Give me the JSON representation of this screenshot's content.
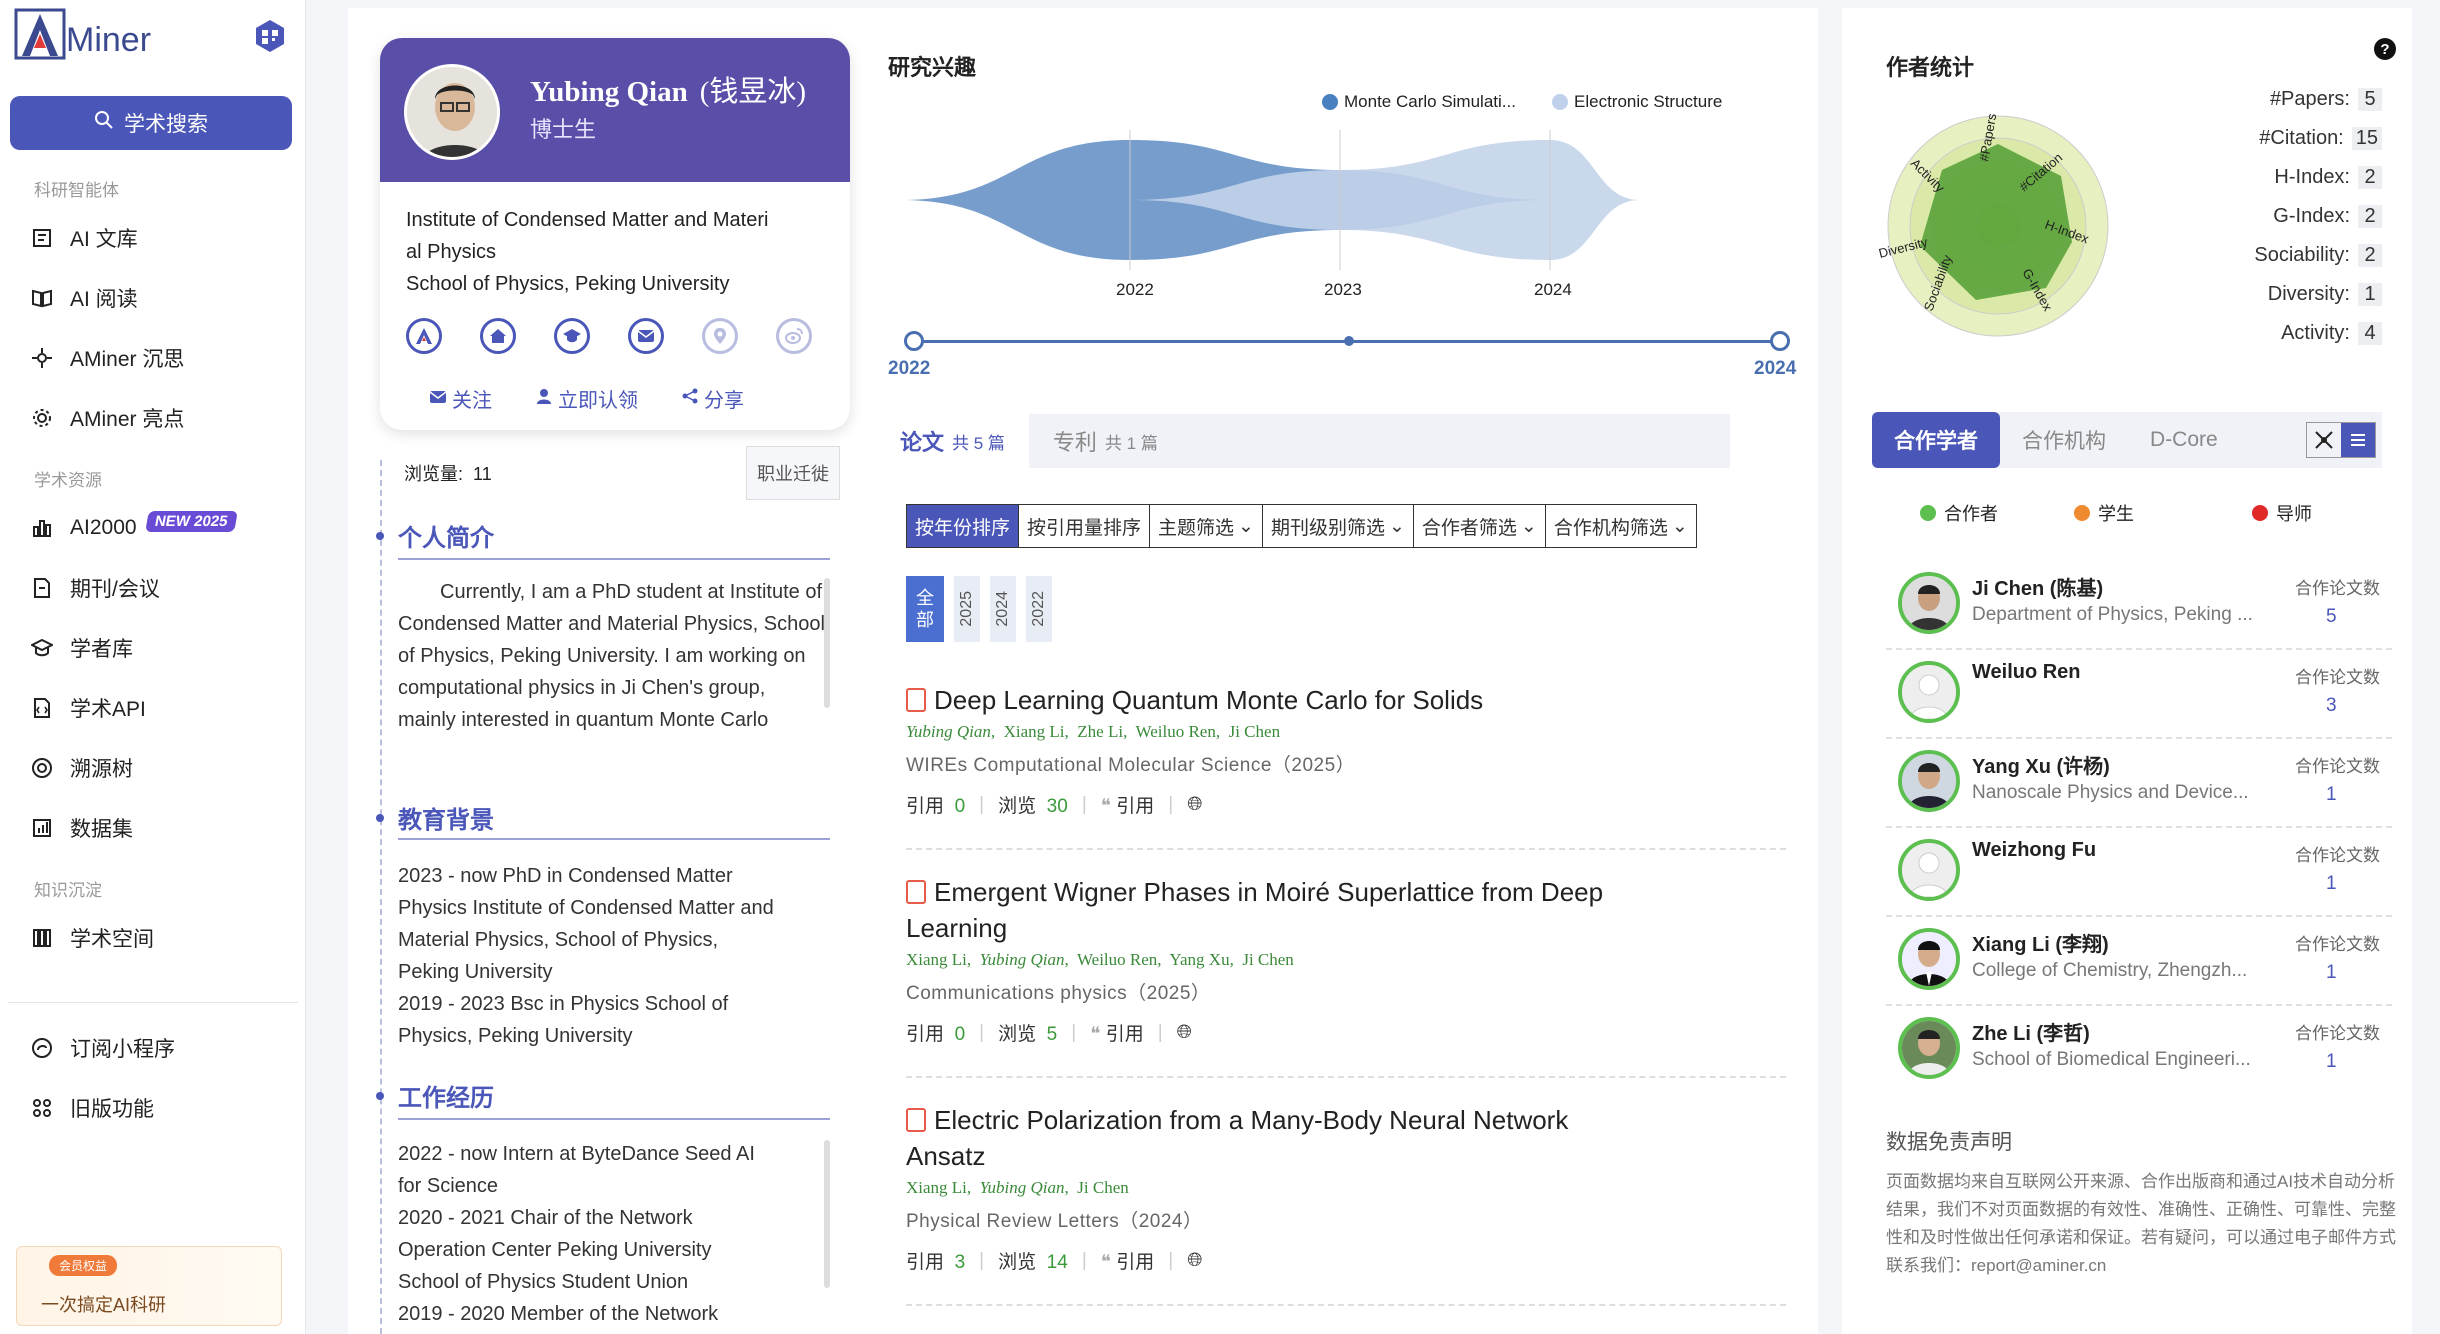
{
  "sidebar": {
    "logo_text": "Miner",
    "search_label": "学术搜索",
    "section1": "科研智能体",
    "section2": "学术资源",
    "section3": "知识沉淀",
    "items1": [
      "AI 文库",
      "AI 阅读",
      "AMiner 沉思",
      "AMiner 亮点"
    ],
    "items2": [
      "AI2000",
      "期刊/会议",
      "学者库",
      "学术API",
      "溯源树",
      "数据集"
    ],
    "items3": [
      "学术空间"
    ],
    "items4": [
      "订阅小程序",
      "旧版功能"
    ],
    "new_badge": "NEW 2025",
    "promo_tag": "会员权益",
    "promo_text": "一次搞定AI科研"
  },
  "profile": {
    "name": "Yubing Qian",
    "name_cn": "(钱昱冰)",
    "title": "博士生",
    "affiliation": "Institute of Condensed Matter and Materi al Physics School of Physics, Peking University",
    "aff_line1": "Institute of Condensed Matter and Materi",
    "aff_line2": "al Physics",
    "aff_line3": "School of Physics, Peking University",
    "action_follow": "关注",
    "action_claim": "立即认领",
    "action_share": "分享",
    "views_label": "浏览量:",
    "views_value": "11",
    "career_btn": "职业迁徙"
  },
  "bio": {
    "title": "个人简介",
    "text": "Currently, I am a PhD student at Institute of Condensed Matter and Material Physics, School of Physics, Peking University. I am working on computational physics in Ji Chen's group, mainly interested in quantum Monte Carlo"
  },
  "education": {
    "title": "教育背景",
    "lines": [
      "2023 - now PhD in Condensed Matter",
      "Physics Institute of Condensed Matter and",
      "Material Physics, School of Physics,",
      "Peking University",
      "2019 - 2023 Bsc in Physics School of",
      "Physics, Peking University"
    ]
  },
  "work": {
    "title": "工作经历",
    "lines": [
      "2022 - now Intern at ByteDance Seed AI",
      "for Science",
      "2020 - 2021 Chair of the Network",
      "Operation Center Peking University",
      "School of Physics Student Union",
      "2019 - 2020 Member of the Network"
    ]
  },
  "research": {
    "title": "研究兴趣",
    "legend": [
      "Monte Carlo Simulati...",
      "Electronic Structure"
    ],
    "ticks": [
      "2022",
      "2023",
      "2024"
    ],
    "slider_start": "2022",
    "slider_end": "2024"
  },
  "chart_data": {
    "type": "area",
    "x": [
      "2022",
      "2023",
      "2024"
    ],
    "series": [
      {
        "name": "Monte Carlo Simulati...",
        "values": [
          2,
          1,
          0
        ]
      },
      {
        "name": "Electronic Structure",
        "values": [
          0,
          1,
          2
        ]
      }
    ],
    "colors": [
      "#6f98c8",
      "#c4d4ea"
    ]
  },
  "tabs": {
    "papers_label": "论文",
    "papers_count": "共 5 篇",
    "patents_label": "专利",
    "patents_count": "共 1 篇"
  },
  "filters": [
    "按年份排序",
    "按引用量排序",
    "主题筛选",
    "期刊级别筛选",
    "合作者筛选",
    "合作机构筛选"
  ],
  "year_tabs": {
    "all_1": "全",
    "all_2": "部",
    "years": [
      "2025",
      "2024",
      "2022"
    ]
  },
  "papers": [
    {
      "title": "Deep Learning Quantum Monte Carlo for Solids",
      "authors": [
        "Yubing Qian",
        "Xiang Li",
        "Zhe Li",
        "Weiluo Ren",
        "Ji Chen"
      ],
      "venue": "WIREs Computational Molecular Science（2025）",
      "cite_label": "引用",
      "cites": "0",
      "views_label": "浏览",
      "views": "30",
      "quote_label": "引用"
    },
    {
      "title_line1": "Emergent Wigner Phases in Moiré Superlattice from Deep",
      "title_line2": "Learning",
      "authors": [
        "Xiang Li",
        "Yubing Qian",
        "Weiluo Ren",
        "Yang Xu",
        "Ji Chen"
      ],
      "venue": "Communications physics（2025）",
      "cite_label": "引用",
      "cites": "0",
      "views_label": "浏览",
      "views": "5",
      "quote_label": "引用"
    },
    {
      "title_line1": "Electric Polarization from a Many-Body Neural Network",
      "title_line2": "Ansatz",
      "authors": [
        "Xiang Li",
        "Yubing Qian",
        "Ji Chen"
      ],
      "venue": "Physical Review Letters（2024）",
      "cite_label": "引用",
      "cites": "3",
      "views_label": "浏览",
      "views": "14",
      "quote_label": "引用"
    }
  ],
  "author_stats": {
    "title": "作者统计",
    "radar_labels": [
      "#Papers",
      "#Citation",
      "H-Index",
      "G-Index",
      "Sociability",
      "Diversity",
      "Activity"
    ],
    "rows": [
      {
        "label": "#Papers:",
        "value": "5"
      },
      {
        "label": "#Citation:",
        "value": "15"
      },
      {
        "label": "H-Index:",
        "value": "2"
      },
      {
        "label": "G-Index:",
        "value": "2"
      },
      {
        "label": "Sociability:",
        "value": "2"
      },
      {
        "label": "Diversity:",
        "value": "1"
      },
      {
        "label": "Activity:",
        "value": "4"
      }
    ]
  },
  "coauthors": {
    "tabs": [
      "合作学者",
      "合作机构",
      "D-Core"
    ],
    "legend": [
      "合作者",
      "学生",
      "导师"
    ],
    "count_label": "合作论文数",
    "list": [
      {
        "name": "Ji Chen (陈基)",
        "aff": "Department of Physics, Peking ...",
        "count": "5"
      },
      {
        "name": "Weiluo Ren",
        "aff": "",
        "count": "3"
      },
      {
        "name": "Yang Xu (许杨)",
        "aff": "Nanoscale Physics and Device...",
        "count": "1"
      },
      {
        "name": "Weizhong Fu",
        "aff": "",
        "count": "1"
      },
      {
        "name": "Xiang Li (李翔)",
        "aff": "College of Chemistry, Zhengzh...",
        "count": "1"
      },
      {
        "name": "Zhe Li (李哲)",
        "aff": "School of Biomedical Engineeri...",
        "count": "1"
      }
    ]
  },
  "disclaimer": {
    "title": "数据免责声明",
    "text": "页面数据均来自互联网公开来源、合作出版商和通过AI技术自动分析结果，我们不对页面数据的有效性、准确性、正确性、可靠性、完整性和及时性做出任何承诺和保证。若有疑问，可以通过电子邮件方式联系我们：report@aminer.cn"
  }
}
